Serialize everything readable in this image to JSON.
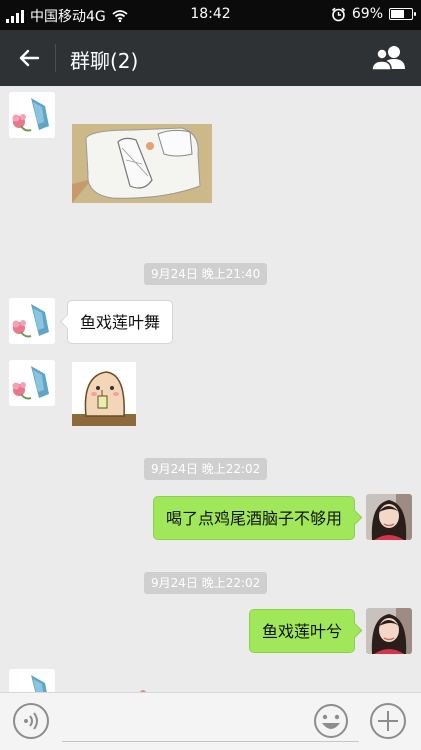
{
  "status_bar": {
    "carrier": "中国移动4G",
    "time": "18:42",
    "battery_percent": "69%",
    "battery_level": 0.69
  },
  "header": {
    "title": "群聊(2)"
  },
  "messages": {
    "time_1": "9月24日 晚上21:40",
    "time_2": "9月24日 晚上22:02",
    "time_3": "9月24日 晚上22:02",
    "text_1": "鱼戏莲叶舞",
    "text_2": "喝了点鸡尾酒脑子不够用",
    "text_3": "鱼戏莲叶兮"
  },
  "colors": {
    "header_bg": "#2f3235",
    "bubble_sent": "#a0e75a",
    "chat_bg": "#ebebeb"
  }
}
